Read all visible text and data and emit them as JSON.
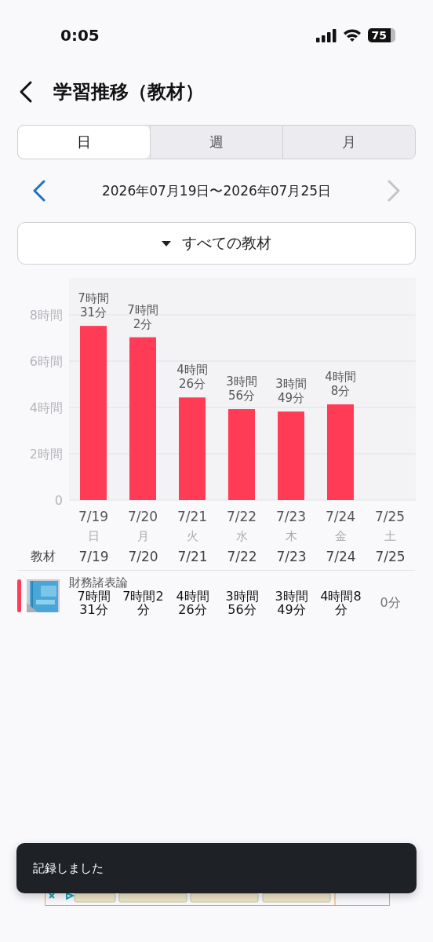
{
  "status_bar": {
    "time": "0:05",
    "battery": "75"
  },
  "header": {
    "title": "学習推移（教材）"
  },
  "tabs": [
    {
      "label": "日",
      "selected": true
    },
    {
      "label": "週",
      "selected": false
    },
    {
      "label": "月",
      "selected": false
    }
  ],
  "date_nav": {
    "range": "2026年07月19日〜2026年07月25日",
    "next_disabled": true
  },
  "filter": {
    "label": "すべての教材"
  },
  "chart": {
    "chart_data": {
      "type": "bar",
      "categories": [
        "7/19",
        "7/20",
        "7/21",
        "7/22",
        "7/23",
        "7/24",
        "7/25"
      ],
      "series": [
        {
          "color": "#ff3b55",
          "values": [
            7.52,
            7.03,
            4.43,
            3.93,
            3.82,
            4.13,
            0
          ]
        }
      ],
      "grid": true,
      "ylim": [
        0,
        8
      ],
      "yticks": [
        {
          "value": 0,
          "label": "0"
        },
        {
          "value": 2,
          "label": "2時間"
        },
        {
          "value": 4,
          "label": "4時間"
        },
        {
          "value": 6,
          "label": "6時間"
        },
        {
          "value": 8,
          "label": "8時間"
        }
      ],
      "value_labels": [
        "7時間\n31分",
        "7時間\n2分",
        "4時間\n26分",
        "3時間\n56分",
        "3時間\n49分",
        "4時間\n8分",
        null
      ]
    },
    "weekdays": [
      "日",
      "月",
      "火",
      "水",
      "木",
      "金",
      "土"
    ]
  },
  "table": {
    "material_header": "教材",
    "columns": [
      "7/19",
      "7/20",
      "7/21",
      "7/22",
      "7/23",
      "7/24",
      "7/25"
    ],
    "rows": [
      {
        "name": "財務諸表論",
        "color": "#ff3b55",
        "cells": [
          "7時間31分",
          "7時間2分",
          "4時間26分",
          "3時間56分",
          "3時間49分",
          "4時間8分",
          "0分"
        ]
      }
    ]
  },
  "toast": {
    "message": "記録しました"
  }
}
